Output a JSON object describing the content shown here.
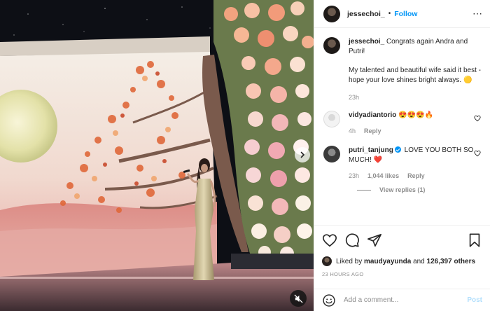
{
  "post": {
    "author": "jessechoi_",
    "separator": "•",
    "follow_label": "Follow",
    "more_icon": "ellipsis-icon",
    "caption": {
      "username": "jessechoi_",
      "line1": "Congrats again Andra and Putri!",
      "line2": "My talented and beautiful wife said it best - hope your love shines bright always. 🟡",
      "time": "23h"
    },
    "comments": [
      {
        "username": "vidyadiantorio",
        "text": "😍😍😍🔥",
        "time": "4h",
        "reply_label": "Reply"
      },
      {
        "username": "putri_tanjung",
        "verified": true,
        "text": "LOVE YOU BOTH SO MUCH! ❤️",
        "time": "23h",
        "likes": "1,044 likes",
        "reply_label": "Reply",
        "view_replies": "View replies (1)"
      }
    ],
    "likes": {
      "prefix": "Liked by",
      "user": "maudyayunda",
      "conjunction": "and",
      "count": "126,397 others"
    },
    "timestamp": "23 HOURS AGO",
    "add_comment": {
      "placeholder": "Add a comment...",
      "post_label": "Post"
    }
  },
  "colors": {
    "accent_blue": "#0095f6",
    "post_disabled": "#b2dffc",
    "muted_text": "#8e8e8e",
    "like_red": "#ed4956"
  }
}
